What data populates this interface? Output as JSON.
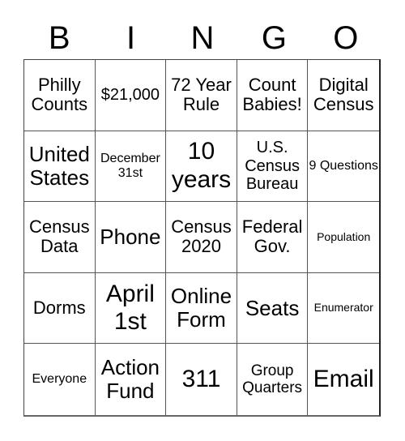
{
  "header": [
    "B",
    "I",
    "N",
    "G",
    "O"
  ],
  "cells": [
    {
      "text": "Philly Counts",
      "size": "m"
    },
    {
      "text": "$21,000",
      "size": "ms"
    },
    {
      "text": "72 Year Rule",
      "size": "m"
    },
    {
      "text": "Count Babies!",
      "size": "m"
    },
    {
      "text": "Digital Census",
      "size": "m"
    },
    {
      "text": "United States",
      "size": "l"
    },
    {
      "text": "December 31st",
      "size": "s"
    },
    {
      "text": "10 years",
      "size": "xl"
    },
    {
      "text": "U.S. Census Bureau",
      "size": "ms"
    },
    {
      "text": "9 Questions",
      "size": "s"
    },
    {
      "text": "Census Data",
      "size": "m"
    },
    {
      "text": "Phone",
      "size": "l"
    },
    {
      "text": "Census 2020",
      "size": "m"
    },
    {
      "text": "Federal Gov.",
      "size": "m"
    },
    {
      "text": "Population",
      "size": "xs"
    },
    {
      "text": "Dorms",
      "size": "m"
    },
    {
      "text": "April 1st",
      "size": "xl"
    },
    {
      "text": "Online Form",
      "size": "l"
    },
    {
      "text": "Seats",
      "size": "l"
    },
    {
      "text": "Enumerator",
      "size": "xs"
    },
    {
      "text": "Everyone",
      "size": "s"
    },
    {
      "text": "Action Fund",
      "size": "l"
    },
    {
      "text": "311",
      "size": "xl"
    },
    {
      "text": "Group Quarters",
      "size": "sm"
    },
    {
      "text": "Email",
      "size": "xl"
    }
  ]
}
